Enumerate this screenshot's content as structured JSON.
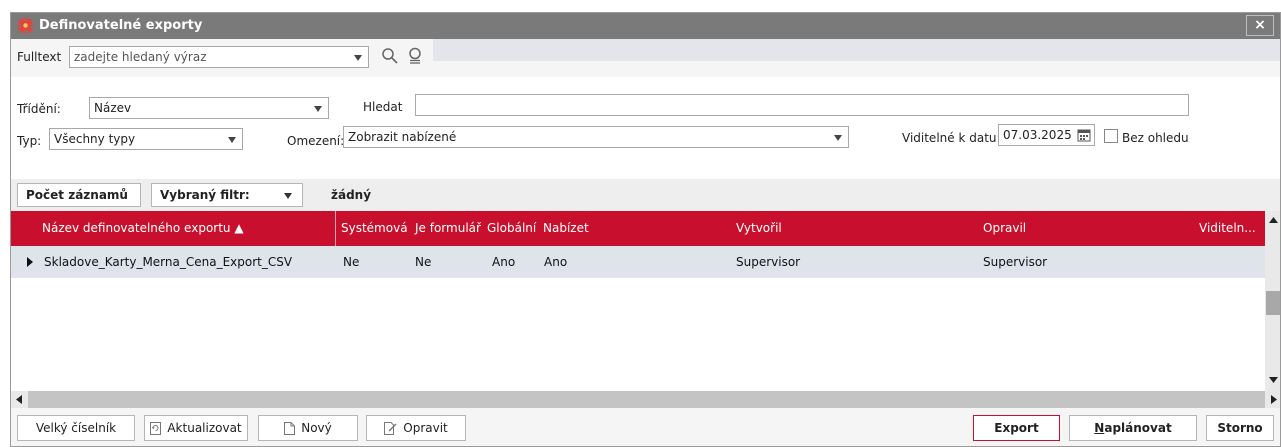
{
  "window": {
    "title": "Definovatelné exporty",
    "close_label": "×"
  },
  "fulltext": {
    "label": "Fulltext",
    "placeholder": "zadejte hledaný výraz"
  },
  "filters": {
    "sort_label": "Třídění:",
    "sort_value": "Název",
    "search_label": "Hledat",
    "search_value": "",
    "type_label": "Typ:",
    "type_value": "Všechny typy",
    "restriction_label": "Omezení:",
    "restriction_value": "Zobrazit nabízené",
    "visible_label": "Viditelné k datu:",
    "visible_date": "07.03.2025",
    "ignore_label": "Bez ohledu"
  },
  "toolbar": {
    "count_label": "Počet záznamů",
    "filter_label": "Vybraný filtr:",
    "filter_value": "žádný"
  },
  "grid": {
    "columns": [
      "Název definovatelného exportu ▲",
      "Systémová",
      "Je formulář",
      "Globální",
      "Nabízet",
      "Vytvořil",
      "Opravil",
      "Viditeln..."
    ],
    "rows": [
      [
        "Skladove_Karty_Merna_Cena_Export_CSV",
        "Ne",
        "Ne",
        "Ano",
        "Ano",
        "Supervisor",
        "Supervisor",
        ""
      ]
    ]
  },
  "footer": {
    "big_dictionary": "Velký číselník",
    "refresh": "Aktualizovat",
    "new": "Nový",
    "edit": "Opravit",
    "export": "Export",
    "schedule_first": "N",
    "schedule_rest": "aplánovat",
    "cancel": "Storno"
  },
  "colors": {
    "header_red": "#c8102e",
    "title_gray": "#7a7a7a",
    "selected_row": "#dfe3ea"
  }
}
